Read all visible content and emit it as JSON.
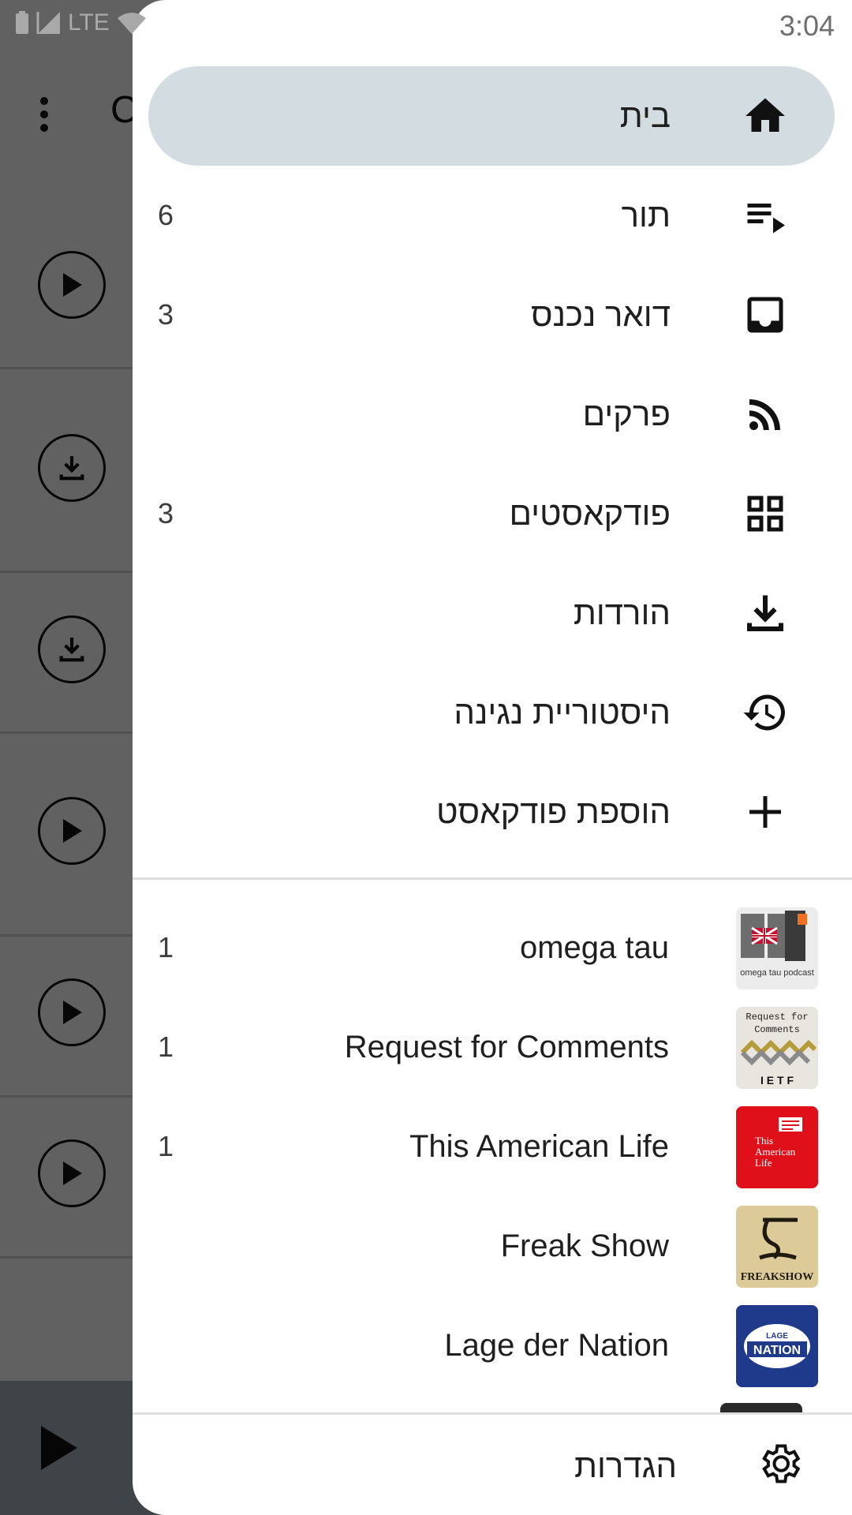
{
  "status_bar": {
    "time": "3:04",
    "network": "LTE"
  },
  "nav": {
    "items": [
      {
        "label": "בית",
        "count": "",
        "icon": "home-icon"
      },
      {
        "label": "תור",
        "count": "6",
        "icon": "queue-icon"
      },
      {
        "label": "דואר נכנס",
        "count": "3",
        "icon": "inbox-icon"
      },
      {
        "label": "פרקים",
        "count": "",
        "icon": "rss-icon"
      },
      {
        "label": "פודקאסטים",
        "count": "3",
        "icon": "grid-icon"
      },
      {
        "label": "הורדות",
        "count": "",
        "icon": "download-icon"
      },
      {
        "label": "היסטוריית נגינה",
        "count": "",
        "icon": "history-icon"
      },
      {
        "label": "הוספת פודקאסט",
        "count": "",
        "icon": "add-icon"
      }
    ]
  },
  "podcasts": [
    {
      "title": "omega tau",
      "count": "1",
      "art_text": "omega tau podcast"
    },
    {
      "title": "Request for Comments",
      "count": "1",
      "art_text": "Request for Comments"
    },
    {
      "title": "This American Life",
      "count": "1",
      "art_text": "This American Life"
    },
    {
      "title": "Freak Show",
      "count": "",
      "art_text": "FREAKSHOW"
    },
    {
      "title": "Lage der Nation",
      "count": "",
      "art_text": "NATION"
    }
  ],
  "footer": {
    "settings_label": "הגדרות"
  },
  "colors": {
    "active_item_bg": "#d3dde1",
    "tal_red": "#e0101a",
    "lage_blue": "#1f3a8a"
  }
}
